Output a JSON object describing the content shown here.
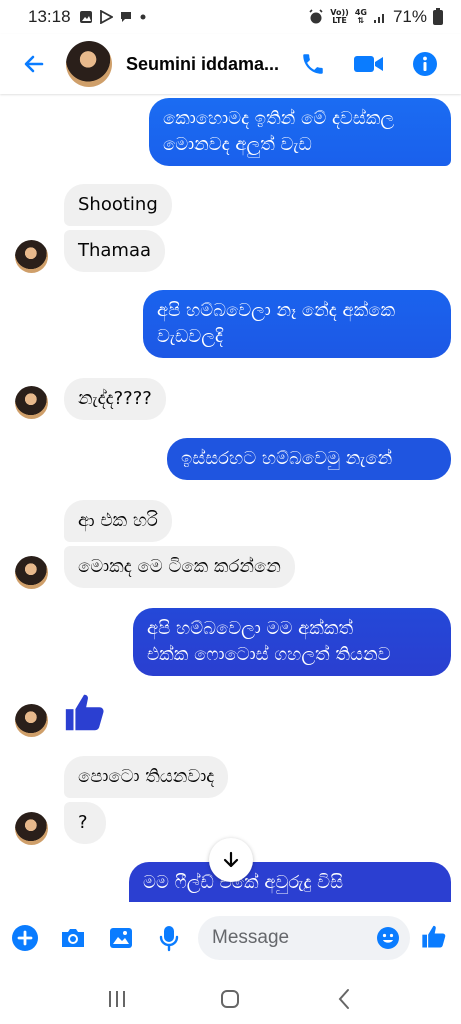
{
  "status": {
    "time": "13:18",
    "left_icons": [
      "gallery-icon",
      "play-icon",
      "chat-bubble-icon",
      "dot-icon"
    ],
    "network_top": "Vo))",
    "network_bottom": "LTE",
    "network_gen": "4G",
    "battery_pct": "71%"
  },
  "header": {
    "contact_name": "Seumini iddama...",
    "back_icon": "back-arrow-icon",
    "call_icon": "phone-icon",
    "video_icon": "video-camera-icon",
    "info_icon": "info-icon"
  },
  "colors": {
    "accent": "#0a7cff",
    "outgoing_top": "#1762f0",
    "outgoing_bottom": "#2b3fd1",
    "incoming": "#f0f0f0"
  },
  "messages": [
    {
      "dir": "out",
      "lines": [
        "කොහොමද ඉතින් මේ දවස්කල",
        "මොනවද අලුත් වැඩ"
      ]
    },
    {
      "dir": "in",
      "lines": [
        "Shooting"
      ]
    },
    {
      "dir": "in",
      "lines": [
        "Thamaa"
      ]
    },
    {
      "dir": "out",
      "lines": [
        "අපි හම්බවෙලා නෑ නේද අක්කෙ",
        "වැඩවලදි"
      ]
    },
    {
      "dir": "in",
      "lines": [
        "නැද්ද????"
      ]
    },
    {
      "dir": "out",
      "lines": [
        "ඉස්සරහට හම්බවෙමු නැනේ"
      ]
    },
    {
      "dir": "in",
      "lines": [
        "ආ එක හරි"
      ]
    },
    {
      "dir": "in",
      "lines": [
        "මොකද මෙ ටිකෙ කරන්නෙ"
      ]
    },
    {
      "dir": "out",
      "lines": [
        "අපි හම්බවෙලා මම අක්කත්",
        "එක්ක ෆොටොස් ගහලත් තියනව"
      ]
    },
    {
      "dir": "in",
      "type": "like-icon"
    },
    {
      "dir": "in",
      "lines": [
        "පොටො තියනවාද"
      ]
    },
    {
      "dir": "in",
      "lines": [
        "?"
      ]
    },
    {
      "dir": "out",
      "lines": [
        "මම ෆීල්ඩ් එකේ අවුරුදු විසි"
      ]
    }
  ],
  "composer": {
    "placeholder": "Message",
    "icons": [
      "plus-icon",
      "camera-icon",
      "image-icon",
      "microphone-icon",
      "emoji-icon",
      "thumbs-up-icon"
    ]
  },
  "navbar": {
    "icons": [
      "recent-apps-icon",
      "home-icon",
      "back-nav-icon"
    ]
  },
  "scroll_button": {
    "icon": "arrow-down-icon"
  }
}
